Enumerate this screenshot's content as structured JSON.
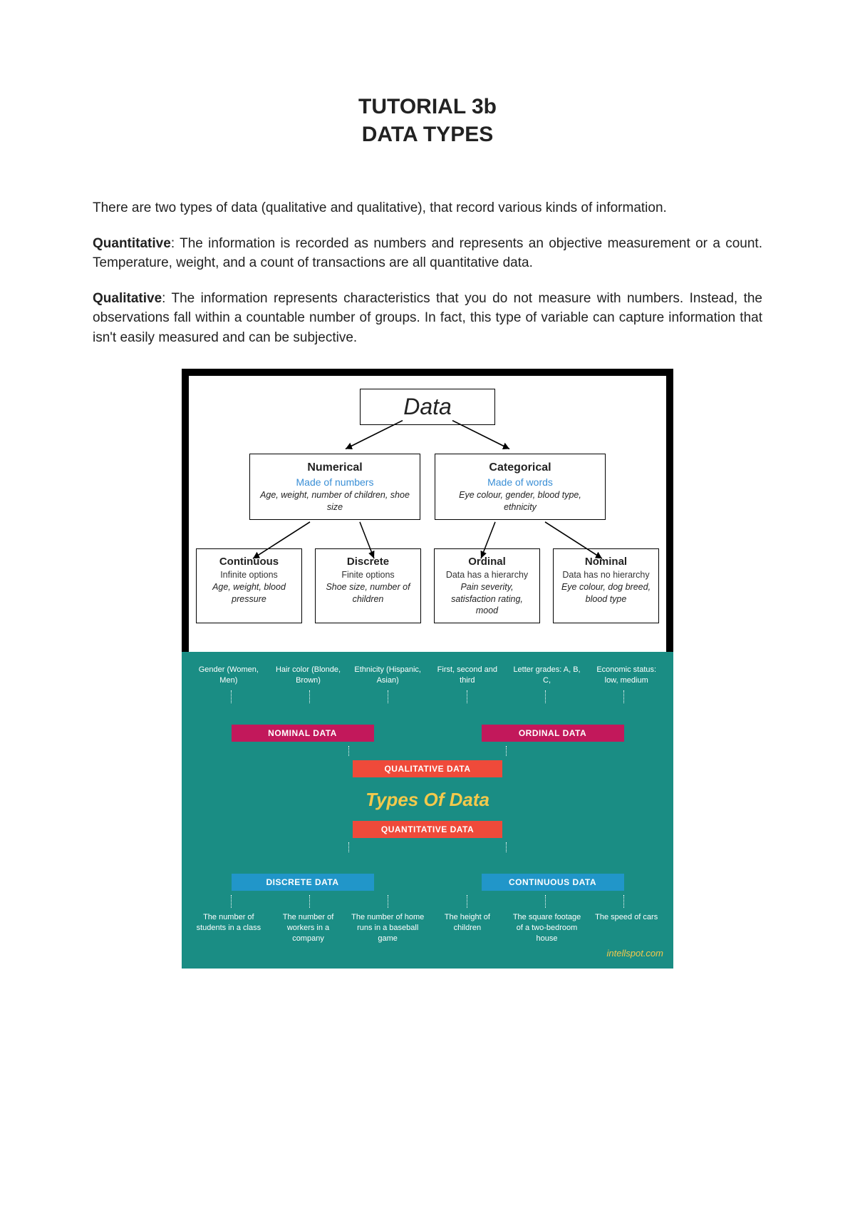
{
  "title": {
    "line1": "TUTORIAL 3b",
    "line2": "DATA TYPES"
  },
  "intro": "There are two types of data (qualitative and qualitative), that record various kinds of information.",
  "quantitative": {
    "label": "Quantitative",
    "text": ": The information is recorded as numbers and represents an objective measurement or a count. Temperature, weight, and a count of transactions are all quantitative data."
  },
  "qualitative": {
    "label": "Qualitative",
    "text": ": The information represents characteristics that you do not measure with numbers. Instead, the observations fall within a countable number of groups. In fact, this type of variable can capture information that isn't easily measured and can be subjective."
  },
  "diagram1": {
    "root": "Data",
    "level1": [
      {
        "title": "Numerical",
        "subtitle": "Made of numbers",
        "examples": "Age, weight, number of children, shoe size"
      },
      {
        "title": "Categorical",
        "subtitle": "Made of words",
        "examples": "Eye colour, gender, blood type, ethnicity"
      }
    ],
    "level2": [
      {
        "title": "Continuous",
        "subtitle": "Infinite options",
        "examples": "Age, weight, blood pressure"
      },
      {
        "title": "Discrete",
        "subtitle": "Finite options",
        "examples": "Shoe size, number of children"
      },
      {
        "title": "Ordinal",
        "subtitle": "Data has a hierarchy",
        "examples": "Pain severity, satisfaction rating, mood"
      },
      {
        "title": "Nominal",
        "subtitle": "Data has no hierarchy",
        "examples": "Eye colour, dog breed, blood type"
      }
    ]
  },
  "diagram2": {
    "top_examples": [
      "Gender (Women, Men)",
      "Hair color (Blonde, Brown)",
      "Ethnicity (Hispanic, Asian)",
      "First, second and third",
      "Letter grades: A, B, C,",
      "Economic status: low, medium"
    ],
    "nominal_label": "NOMINAL DATA",
    "ordinal_label": "ORDINAL DATA",
    "qualitative_label": "QUALITATIVE DATA",
    "center_title": "Types Of Data",
    "quantitative_label": "QUANTITATIVE DATA",
    "discrete_label": "DISCRETE DATA",
    "continuous_label": "CONTINUOUS DATA",
    "bottom_examples": [
      "The number of students in a class",
      "The number of workers in a company",
      "The number of home runs in a baseball game",
      "The height of children",
      "The square footage of a two-bedroom house",
      "The speed of cars"
    ],
    "credit": "intellspot.com"
  }
}
